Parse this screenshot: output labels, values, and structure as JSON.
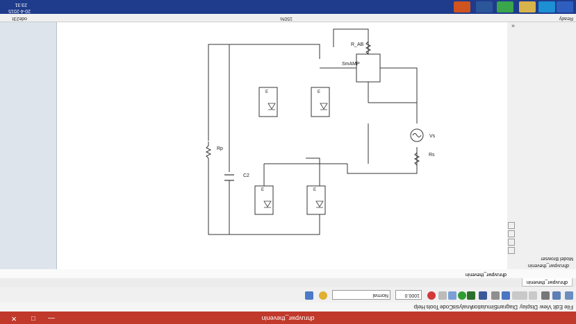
{
  "window": {
    "title": "dhruvpwr_thevenin",
    "controls": {
      "minimize": "—",
      "maximize": "□",
      "close": "✕"
    }
  },
  "menu": [
    "File",
    "Edit",
    "View",
    "Display",
    "Diagram",
    "Simulation",
    "Analysis",
    "Code",
    "Tools",
    "Help"
  ],
  "toolbar": {
    "stop_time": "1000.0",
    "sim_mode": "Normal"
  },
  "model_browser": {
    "tab_label": "dhruvpwr_thevenin",
    "panel_label": "Model Browser",
    "item_label": "dhruvpwr_thevenin"
  },
  "breadcrumb": {
    "path": "dhruvpwr_thevenin"
  },
  "diagram": {
    "labels": {
      "source": "Vs",
      "source_res": "Rs",
      "load_res": "R_AB",
      "meter": "SmAMP",
      "cap": "C2",
      "r_parallel": "Rp",
      "switch_mark": "E"
    }
  },
  "status": {
    "left": "Ready",
    "center": "150%",
    "right": "ode23t"
  },
  "taskbar": {
    "apps": [
      "windows-logo",
      "ie",
      "explorer",
      "chrome",
      "word",
      "matlab"
    ],
    "time": "23:31",
    "date": "20-4-2015"
  }
}
